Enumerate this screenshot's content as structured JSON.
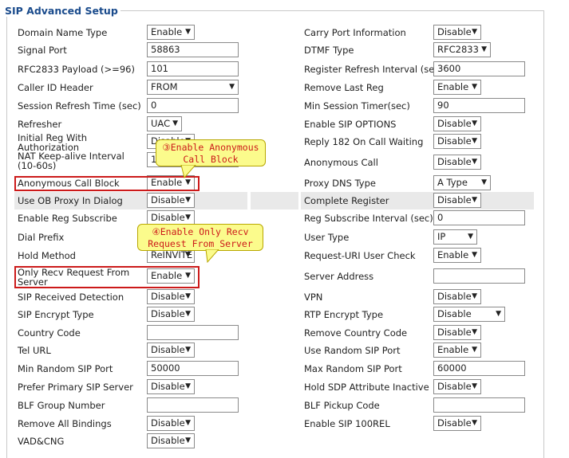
{
  "legend": "SIP Advanced Setup",
  "callouts": {
    "c1": "③Enable Anonymous\nCall Block",
    "c2": "④Enable Only Recv\nRequest From Server"
  },
  "left": [
    {
      "label": "Domain Name Type",
      "type": "select",
      "value": "Enable"
    },
    {
      "label": "Signal Port",
      "type": "input",
      "value": "58863"
    },
    {
      "label": "RFC2833 Payload (>=96)",
      "type": "input",
      "value": "101"
    },
    {
      "label": "Caller ID Header",
      "type": "select",
      "value": "FROM"
    },
    {
      "label": "Session Refresh Time (sec)",
      "type": "input",
      "value": "0"
    },
    {
      "label": "Refresher",
      "type": "select",
      "value": "UAC"
    },
    {
      "label": "Initial Reg With Authorization",
      "type": "select",
      "value": "Disable"
    },
    {
      "label": "NAT Keep-alive Interval (10-60s)",
      "type": "input",
      "value": "15"
    },
    {
      "label": "Anonymous Call Block",
      "type": "select",
      "value": "Enable"
    },
    {
      "label": "Use OB Proxy In Dialog",
      "type": "select",
      "value": "Disable"
    },
    {
      "label": "Enable Reg Subscribe",
      "type": "select",
      "value": "Disable"
    },
    {
      "label": "Dial Prefix",
      "type": "input",
      "value": ""
    },
    {
      "label": "Hold Method",
      "type": "select",
      "value": "ReINVITE"
    },
    {
      "label": "Only Recv Request From Server",
      "type": "select",
      "value": "Enable"
    },
    {
      "label": "SIP Received Detection",
      "type": "select",
      "value": "Disable"
    },
    {
      "label": "SIP Encrypt Type",
      "type": "select",
      "value": "Disable"
    },
    {
      "label": "Country Code",
      "type": "input",
      "value": ""
    },
    {
      "label": "Tel URL",
      "type": "select",
      "value": "Disable"
    },
    {
      "label": "Min Random SIP Port",
      "type": "input",
      "value": "50000"
    },
    {
      "label": "Prefer Primary SIP Server",
      "type": "select",
      "value": "Disable"
    },
    {
      "label": "BLF Group Number",
      "type": "input",
      "value": ""
    },
    {
      "label": "Remove All Bindings",
      "type": "select",
      "value": "Disable"
    },
    {
      "label": "VAD&CNG",
      "type": "select",
      "value": "Disable"
    }
  ],
  "right": [
    {
      "label": "Carry Port Information",
      "type": "select",
      "value": "Disable"
    },
    {
      "label": "DTMF Type",
      "type": "select",
      "value": "RFC2833"
    },
    {
      "label": "Register Refresh Interval (sec)",
      "type": "input",
      "value": "3600"
    },
    {
      "label": "Remove Last Reg",
      "type": "select",
      "value": "Enable"
    },
    {
      "label": "Min Session Timer(sec)",
      "type": "input",
      "value": "90"
    },
    {
      "label": "Enable SIP OPTIONS",
      "type": "select",
      "value": "Disable"
    },
    {
      "label": "Reply 182 On Call Waiting",
      "type": "select",
      "value": "Disable"
    },
    {
      "label": "Anonymous Call",
      "type": "select",
      "value": "Disable"
    },
    {
      "label": "Proxy DNS Type",
      "type": "select",
      "value": "A Type"
    },
    {
      "label": "Complete Register",
      "type": "select",
      "value": "Disable"
    },
    {
      "label": "Reg Subscribe Interval (sec)",
      "type": "input",
      "value": "0"
    },
    {
      "label": "User Type",
      "type": "select",
      "value": "IP"
    },
    {
      "label": "Request-URI User Check",
      "type": "select",
      "value": "Enable"
    },
    {
      "label": "Server Address",
      "type": "input",
      "value": ""
    },
    {
      "label": "VPN",
      "type": "select",
      "value": "Disable"
    },
    {
      "label": "RTP Encrypt Type",
      "type": "select",
      "value": "Disable"
    },
    {
      "label": "Remove Country Code",
      "type": "select",
      "value": "Disable"
    },
    {
      "label": "Use Random SIP Port",
      "type": "select",
      "value": "Enable"
    },
    {
      "label": "Max Random SIP Port",
      "type": "input",
      "value": "60000"
    },
    {
      "label": "Hold SDP Attribute Inactive",
      "type": "select",
      "value": "Disable"
    },
    {
      "label": "BLF Pickup Code",
      "type": "input",
      "value": ""
    },
    {
      "label": "Enable SIP 100REL",
      "type": "select",
      "value": "Disable"
    }
  ]
}
